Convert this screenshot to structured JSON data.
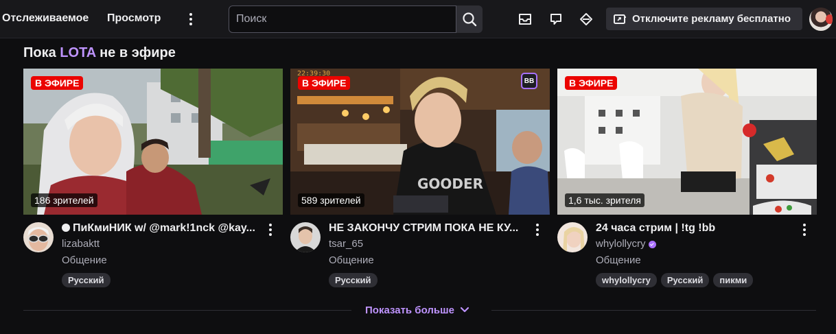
{
  "nav": {
    "following": "Отслеживаемое",
    "browse": "Просмотр"
  },
  "search": {
    "placeholder": "Поиск"
  },
  "ad_free": {
    "label": "Отключите рекламу бесплатно"
  },
  "section": {
    "prefix": "Пока",
    "channel": "LOTA",
    "suffix": "не в эфире"
  },
  "cards": [
    {
      "live_label": "В ЭФИРЕ",
      "viewers": "186 зрителей",
      "title": "ПиКмиНИК w/ @mark!1nck @kay...",
      "channel": "lizabaktt",
      "category": "Общение",
      "tags": [
        "Русский"
      ]
    },
    {
      "live_label": "В ЭФИРЕ",
      "viewers": "589 зрителей",
      "title": "НЕ ЗАКОНЧУ СТРИМ ПОКА НЕ КУ...",
      "channel": "tsar_65",
      "category": "Общение",
      "tags": [
        "Русский"
      ],
      "thumb_badge": "BB"
    },
    {
      "live_label": "В ЭФИРЕ",
      "viewers": "1,6 тыс. зрителя",
      "title": "24 часа стрим | !tg !bb",
      "channel": "whylollycry",
      "category": "Общение",
      "tags": [
        "whylollycry",
        "Русский",
        "пикми"
      ]
    }
  ],
  "show_more": "Показать больше",
  "colors": {
    "background": "#0e0e10",
    "topbar": "#18181b",
    "accent": "#bf94ff",
    "live": "#eb0400",
    "tag_bg": "#2f2f35"
  }
}
